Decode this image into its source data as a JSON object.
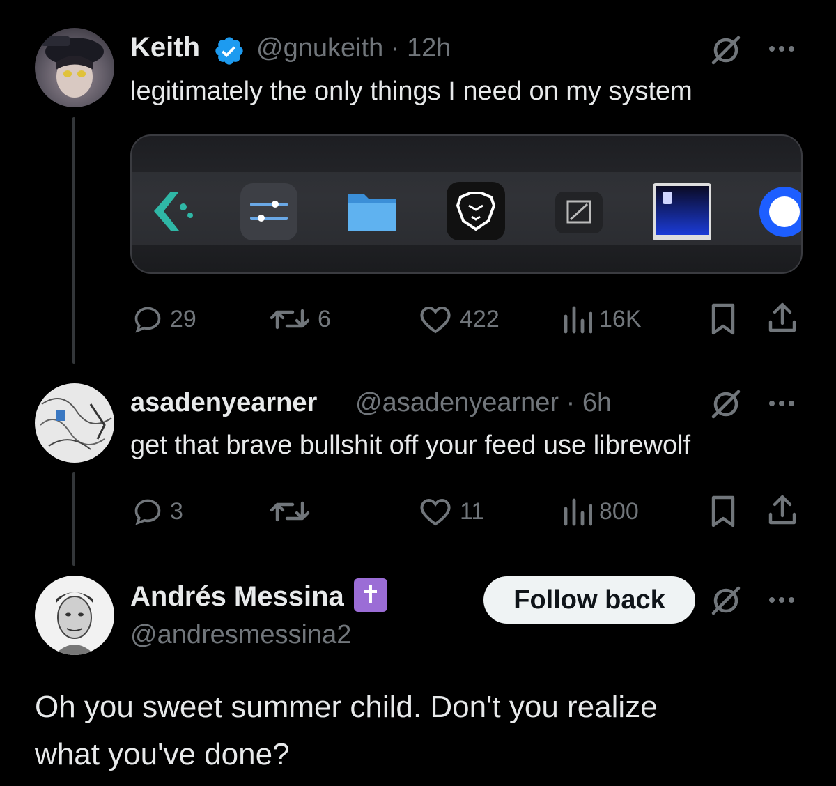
{
  "tweets": [
    {
      "name": "Keith",
      "verified": true,
      "handle": "@gnukeith",
      "separator": "·",
      "time": "12h",
      "text": "legitimately the only things I need on my system",
      "media": {
        "apps": [
          "kde-connect-icon",
          "settings-sliders-icon",
          "files-folder-icon",
          "brave-lion-icon",
          "zed-editor-icon",
          "terminal-icon",
          "blue-sun-icon"
        ]
      },
      "stats": {
        "replies": "29",
        "reposts": "6",
        "likes": "422",
        "views": "16K"
      }
    },
    {
      "name": "asadenyearner",
      "handle": "@asadenyearner",
      "separator": "·",
      "time": "6h",
      "text": "get that brave bullshit off your feed use librewolf",
      "stats": {
        "replies": "3",
        "reposts": "",
        "likes": "11",
        "views": "800"
      }
    },
    {
      "name": "Andrés Messina",
      "badge": "✝",
      "handle": "@andresmessina2",
      "follow_label": "Follow back",
      "text_line1": "Oh you sweet summer child. Don't you realize",
      "text_line2": "what you've done?"
    }
  ],
  "colors": {
    "background": "#000000",
    "text": "#e7e9ea",
    "muted": "#71767b",
    "verified": "#1d9bf0",
    "badge": "#9b6dd6"
  }
}
